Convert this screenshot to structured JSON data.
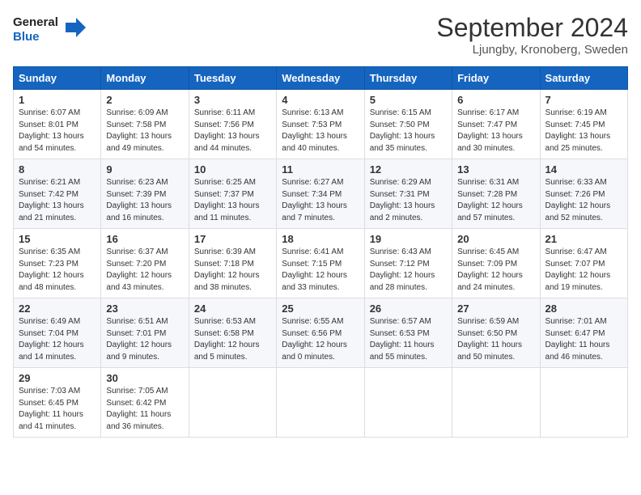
{
  "header": {
    "logo_general": "General",
    "logo_blue": "Blue",
    "title": "September 2024",
    "subtitle": "Ljungby, Kronoberg, Sweden"
  },
  "days_of_week": [
    "Sunday",
    "Monday",
    "Tuesday",
    "Wednesday",
    "Thursday",
    "Friday",
    "Saturday"
  ],
  "weeks": [
    [
      {
        "day": "1",
        "sunrise": "6:07 AM",
        "sunset": "8:01 PM",
        "daylight": "13 hours and 54 minutes."
      },
      {
        "day": "2",
        "sunrise": "6:09 AM",
        "sunset": "7:58 PM",
        "daylight": "13 hours and 49 minutes."
      },
      {
        "day": "3",
        "sunrise": "6:11 AM",
        "sunset": "7:56 PM",
        "daylight": "13 hours and 44 minutes."
      },
      {
        "day": "4",
        "sunrise": "6:13 AM",
        "sunset": "7:53 PM",
        "daylight": "13 hours and 40 minutes."
      },
      {
        "day": "5",
        "sunrise": "6:15 AM",
        "sunset": "7:50 PM",
        "daylight": "13 hours and 35 minutes."
      },
      {
        "day": "6",
        "sunrise": "6:17 AM",
        "sunset": "7:47 PM",
        "daylight": "13 hours and 30 minutes."
      },
      {
        "day": "7",
        "sunrise": "6:19 AM",
        "sunset": "7:45 PM",
        "daylight": "13 hours and 25 minutes."
      }
    ],
    [
      {
        "day": "8",
        "sunrise": "6:21 AM",
        "sunset": "7:42 PM",
        "daylight": "13 hours and 21 minutes."
      },
      {
        "day": "9",
        "sunrise": "6:23 AM",
        "sunset": "7:39 PM",
        "daylight": "13 hours and 16 minutes."
      },
      {
        "day": "10",
        "sunrise": "6:25 AM",
        "sunset": "7:37 PM",
        "daylight": "13 hours and 11 minutes."
      },
      {
        "day": "11",
        "sunrise": "6:27 AM",
        "sunset": "7:34 PM",
        "daylight": "13 hours and 7 minutes."
      },
      {
        "day": "12",
        "sunrise": "6:29 AM",
        "sunset": "7:31 PM",
        "daylight": "13 hours and 2 minutes."
      },
      {
        "day": "13",
        "sunrise": "6:31 AM",
        "sunset": "7:28 PM",
        "daylight": "12 hours and 57 minutes."
      },
      {
        "day": "14",
        "sunrise": "6:33 AM",
        "sunset": "7:26 PM",
        "daylight": "12 hours and 52 minutes."
      }
    ],
    [
      {
        "day": "15",
        "sunrise": "6:35 AM",
        "sunset": "7:23 PM",
        "daylight": "12 hours and 48 minutes."
      },
      {
        "day": "16",
        "sunrise": "6:37 AM",
        "sunset": "7:20 PM",
        "daylight": "12 hours and 43 minutes."
      },
      {
        "day": "17",
        "sunrise": "6:39 AM",
        "sunset": "7:18 PM",
        "daylight": "12 hours and 38 minutes."
      },
      {
        "day": "18",
        "sunrise": "6:41 AM",
        "sunset": "7:15 PM",
        "daylight": "12 hours and 33 minutes."
      },
      {
        "day": "19",
        "sunrise": "6:43 AM",
        "sunset": "7:12 PM",
        "daylight": "12 hours and 28 minutes."
      },
      {
        "day": "20",
        "sunrise": "6:45 AM",
        "sunset": "7:09 PM",
        "daylight": "12 hours and 24 minutes."
      },
      {
        "day": "21",
        "sunrise": "6:47 AM",
        "sunset": "7:07 PM",
        "daylight": "12 hours and 19 minutes."
      }
    ],
    [
      {
        "day": "22",
        "sunrise": "6:49 AM",
        "sunset": "7:04 PM",
        "daylight": "12 hours and 14 minutes."
      },
      {
        "day": "23",
        "sunrise": "6:51 AM",
        "sunset": "7:01 PM",
        "daylight": "12 hours and 9 minutes."
      },
      {
        "day": "24",
        "sunrise": "6:53 AM",
        "sunset": "6:58 PM",
        "daylight": "12 hours and 5 minutes."
      },
      {
        "day": "25",
        "sunrise": "6:55 AM",
        "sunset": "6:56 PM",
        "daylight": "12 hours and 0 minutes."
      },
      {
        "day": "26",
        "sunrise": "6:57 AM",
        "sunset": "6:53 PM",
        "daylight": "11 hours and 55 minutes."
      },
      {
        "day": "27",
        "sunrise": "6:59 AM",
        "sunset": "6:50 PM",
        "daylight": "11 hours and 50 minutes."
      },
      {
        "day": "28",
        "sunrise": "7:01 AM",
        "sunset": "6:47 PM",
        "daylight": "11 hours and 46 minutes."
      }
    ],
    [
      {
        "day": "29",
        "sunrise": "7:03 AM",
        "sunset": "6:45 PM",
        "daylight": "11 hours and 41 minutes."
      },
      {
        "day": "30",
        "sunrise": "7:05 AM",
        "sunset": "6:42 PM",
        "daylight": "11 hours and 36 minutes."
      },
      null,
      null,
      null,
      null,
      null
    ]
  ],
  "labels": {
    "sunrise": "Sunrise:",
    "sunset": "Sunset:",
    "daylight": "Daylight:"
  }
}
